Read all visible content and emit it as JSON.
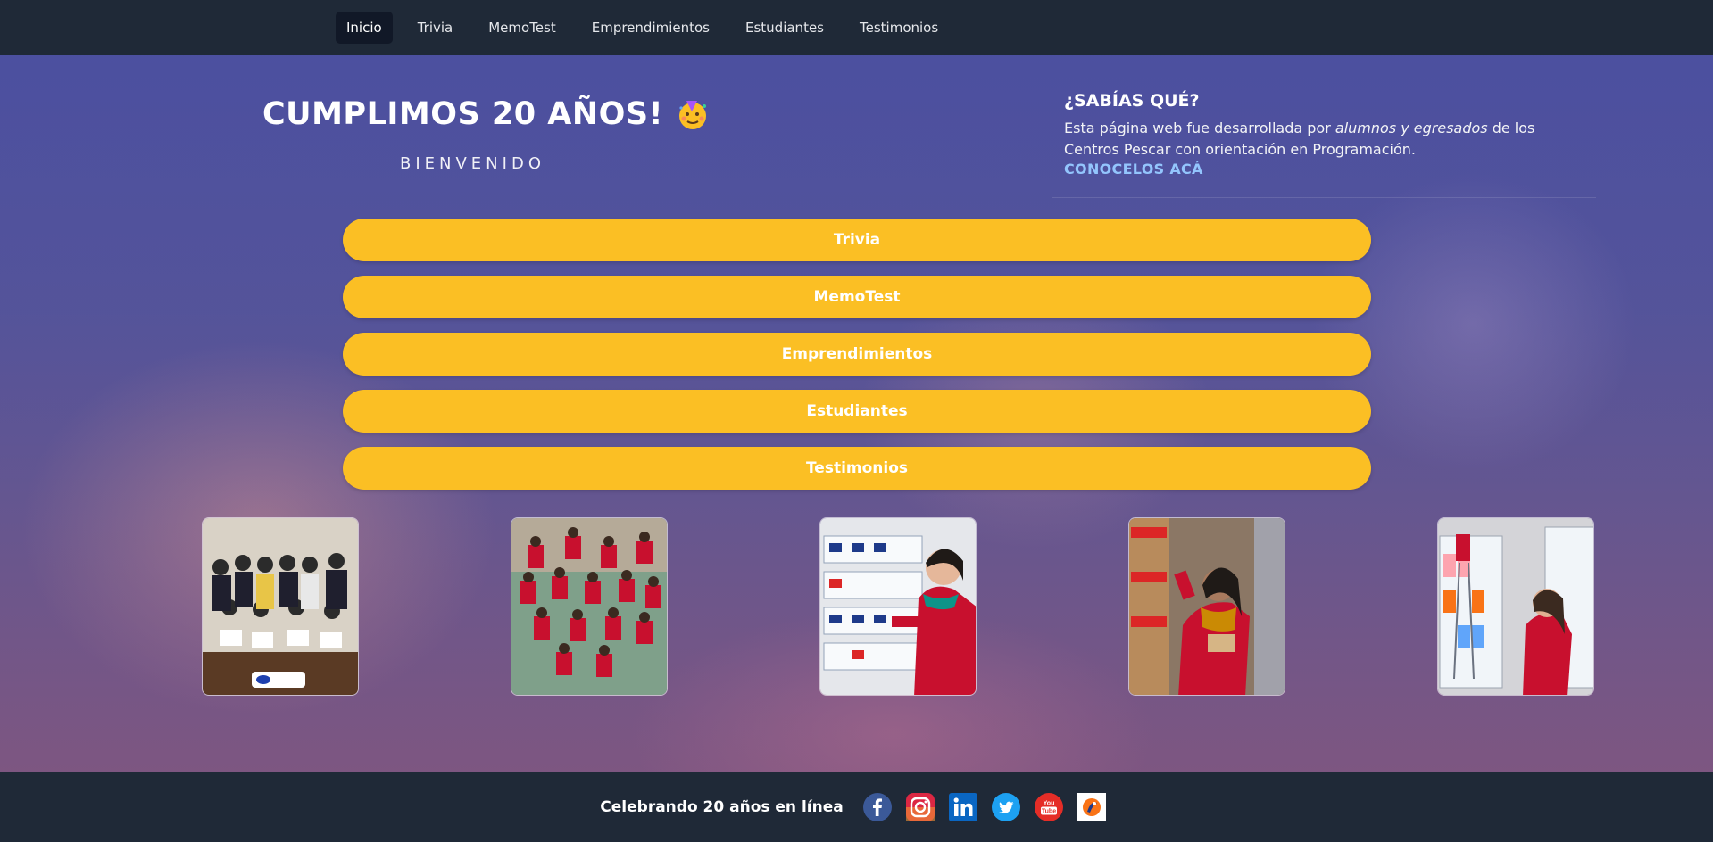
{
  "nav": {
    "items": [
      {
        "label": "Inicio",
        "active": true
      },
      {
        "label": "Trivia"
      },
      {
        "label": "MemoTest"
      },
      {
        "label": "Emprendimientos"
      },
      {
        "label": "Estudiantes"
      },
      {
        "label": "Testimonios"
      }
    ]
  },
  "hero": {
    "title": "CUMPLIMOS 20 AÑOS!",
    "title_icon": "party-face-icon",
    "subtitle": "BIENVENIDO"
  },
  "info": {
    "title": "¿SABÍAS QUÉ?",
    "text_before": "Esta página web fue desarrollada por ",
    "text_emphasis": "alumnos y egresados",
    "text_after": " de los Centros Pescar con orientación en Programación.",
    "link": "CONOCELOS ACÁ"
  },
  "buttons": [
    "Trivia",
    "MemoTest",
    "Emprendimientos",
    "Estudiantes",
    "Testimonios"
  ],
  "photos": [
    {
      "name": "photo-graduates-group"
    },
    {
      "name": "photo-team-red-jackets"
    },
    {
      "name": "photo-student-shelves"
    },
    {
      "name": "photo-student-warehouse"
    },
    {
      "name": "photo-student-storage"
    }
  ],
  "footer": {
    "text": "Celebrando 20 años en línea",
    "social": [
      {
        "name": "facebook-icon",
        "color": "#3b5998"
      },
      {
        "name": "instagram-icon",
        "color": "#e1306c"
      },
      {
        "name": "linkedin-icon",
        "color": "#0a66c2"
      },
      {
        "name": "twitter-icon",
        "color": "#1da1f2"
      },
      {
        "name": "youtube-icon",
        "color": "#e52d27"
      },
      {
        "name": "pescar-logo-icon",
        "color": "#f97316"
      }
    ]
  },
  "colors": {
    "accent_button": "#fbbf24",
    "nav_bg": "#1f2937",
    "link": "#93c5fd"
  }
}
